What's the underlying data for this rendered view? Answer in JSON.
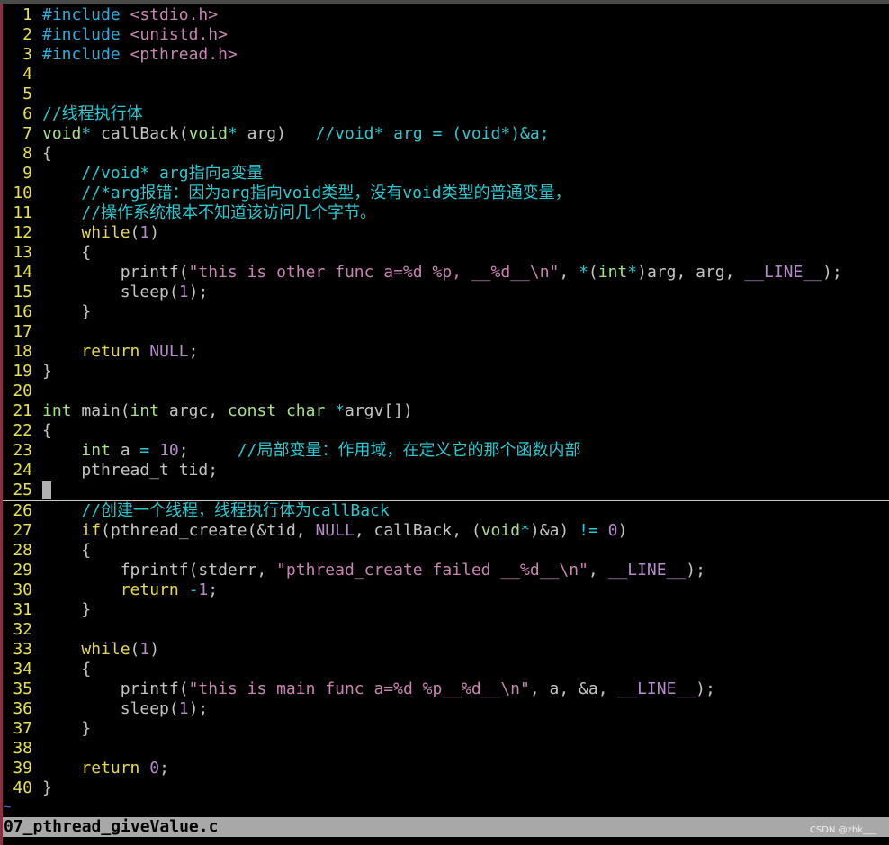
{
  "editor": {
    "cursor_line": 25,
    "lines": [
      [
        [
          "p",
          "#include"
        ],
        [
          "n",
          " "
        ],
        [
          "s",
          "<stdio.h>"
        ]
      ],
      [
        [
          "p",
          "#include"
        ],
        [
          "n",
          " "
        ],
        [
          "s",
          "<unistd.h>"
        ]
      ],
      [
        [
          "p",
          "#include"
        ],
        [
          "n",
          " "
        ],
        [
          "s",
          "<pthread.h>"
        ]
      ],
      [],
      [],
      [
        [
          "c",
          "//线程执行体"
        ]
      ],
      [
        [
          "t",
          "void"
        ],
        [
          "o",
          "*"
        ],
        [
          "n",
          " callBack("
        ],
        [
          "t",
          "void"
        ],
        [
          "o",
          "*"
        ],
        [
          "n",
          " arg)   "
        ],
        [
          "c",
          "//void* arg = (void*)&a;"
        ]
      ],
      [
        [
          "n",
          "{"
        ]
      ],
      [
        [
          "n",
          "    "
        ],
        [
          "c",
          "//void* arg指向a变量"
        ]
      ],
      [
        [
          "n",
          "    "
        ],
        [
          "c",
          "//*arg报错：因为arg指向void类型，没有void类型的普通变量，"
        ]
      ],
      [
        [
          "n",
          "    "
        ],
        [
          "c",
          "//操作系统根本不知道该访问几个字节。"
        ]
      ],
      [
        [
          "n",
          "    "
        ],
        [
          "k",
          "while"
        ],
        [
          "n",
          "("
        ],
        [
          "m",
          "1"
        ],
        [
          "n",
          ")"
        ]
      ],
      [
        [
          "n",
          "    {"
        ]
      ],
      [
        [
          "n",
          "        printf("
        ],
        [
          "s",
          "\"this is other func a=%d %p, __%d__\\n\""
        ],
        [
          "n",
          ", "
        ],
        [
          "o",
          "*"
        ],
        [
          "n",
          "("
        ],
        [
          "t",
          "int"
        ],
        [
          "o",
          "*"
        ],
        [
          "n",
          ")arg, arg, "
        ],
        [
          "m",
          "__LINE__"
        ],
        [
          "n",
          ");"
        ]
      ],
      [
        [
          "n",
          "        sleep("
        ],
        [
          "m",
          "1"
        ],
        [
          "n",
          ");"
        ]
      ],
      [
        [
          "n",
          "    }"
        ]
      ],
      [],
      [
        [
          "n",
          "    "
        ],
        [
          "k",
          "return"
        ],
        [
          "n",
          " "
        ],
        [
          "m",
          "NULL"
        ],
        [
          "n",
          ";"
        ]
      ],
      [
        [
          "n",
          "}"
        ]
      ],
      [],
      [
        [
          "t",
          "int"
        ],
        [
          "n",
          " main("
        ],
        [
          "t",
          "int"
        ],
        [
          "n",
          " argc, "
        ],
        [
          "t",
          "const char"
        ],
        [
          "n",
          " "
        ],
        [
          "o",
          "*"
        ],
        [
          "n",
          "argv[])"
        ]
      ],
      [
        [
          "n",
          "{"
        ]
      ],
      [
        [
          "n",
          "    "
        ],
        [
          "t",
          "int"
        ],
        [
          "n",
          " a "
        ],
        [
          "o",
          "="
        ],
        [
          "n",
          " "
        ],
        [
          "m",
          "10"
        ],
        [
          "n",
          ";     "
        ],
        [
          "c",
          "//局部变量：作用域，在定义它的那个函数内部"
        ]
      ],
      [
        [
          "n",
          "    pthread_t tid;"
        ]
      ],
      [],
      [
        [
          "n",
          "    "
        ],
        [
          "c",
          "//创建一个线程，线程执行体为callBack"
        ]
      ],
      [
        [
          "n",
          "    "
        ],
        [
          "k",
          "if"
        ],
        [
          "n",
          "(pthread_create(&tid, "
        ],
        [
          "m",
          "NULL"
        ],
        [
          "n",
          ", callBack, ("
        ],
        [
          "t",
          "void"
        ],
        [
          "o",
          "*"
        ],
        [
          "n",
          ")&a) "
        ],
        [
          "o",
          "!="
        ],
        [
          "n",
          " "
        ],
        [
          "m",
          "0"
        ],
        [
          "n",
          ")"
        ]
      ],
      [
        [
          "n",
          "    {"
        ]
      ],
      [
        [
          "n",
          "        fprintf(stderr, "
        ],
        [
          "s",
          "\"pthread_create failed __%d__\\n\""
        ],
        [
          "n",
          ", "
        ],
        [
          "m",
          "__LINE__"
        ],
        [
          "n",
          ");"
        ]
      ],
      [
        [
          "n",
          "        "
        ],
        [
          "k",
          "return"
        ],
        [
          "n",
          " "
        ],
        [
          "o",
          "-"
        ],
        [
          "m",
          "1"
        ],
        [
          "n",
          ";"
        ]
      ],
      [
        [
          "n",
          "    }"
        ]
      ],
      [],
      [
        [
          "n",
          "    "
        ],
        [
          "k",
          "while"
        ],
        [
          "n",
          "("
        ],
        [
          "m",
          "1"
        ],
        [
          "n",
          ")"
        ]
      ],
      [
        [
          "n",
          "    {"
        ]
      ],
      [
        [
          "n",
          "        printf("
        ],
        [
          "s",
          "\"this is main func a=%d %p__%d__\\n\""
        ],
        [
          "n",
          ", a, &a, "
        ],
        [
          "m",
          "__LINE__"
        ],
        [
          "n",
          ");"
        ]
      ],
      [
        [
          "n",
          "        sleep("
        ],
        [
          "m",
          "1"
        ],
        [
          "n",
          ");"
        ]
      ],
      [
        [
          "n",
          "    }"
        ]
      ],
      [],
      [
        [
          "n",
          "    "
        ],
        [
          "k",
          "return"
        ],
        [
          "n",
          " "
        ],
        [
          "m",
          "0"
        ],
        [
          "n",
          ";"
        ]
      ],
      [
        [
          "n",
          "}"
        ]
      ]
    ],
    "tilde": "~"
  },
  "statusline": {
    "filename": "07_pthread_giveValue.c"
  },
  "watermark": "CSDN @zhk___"
}
